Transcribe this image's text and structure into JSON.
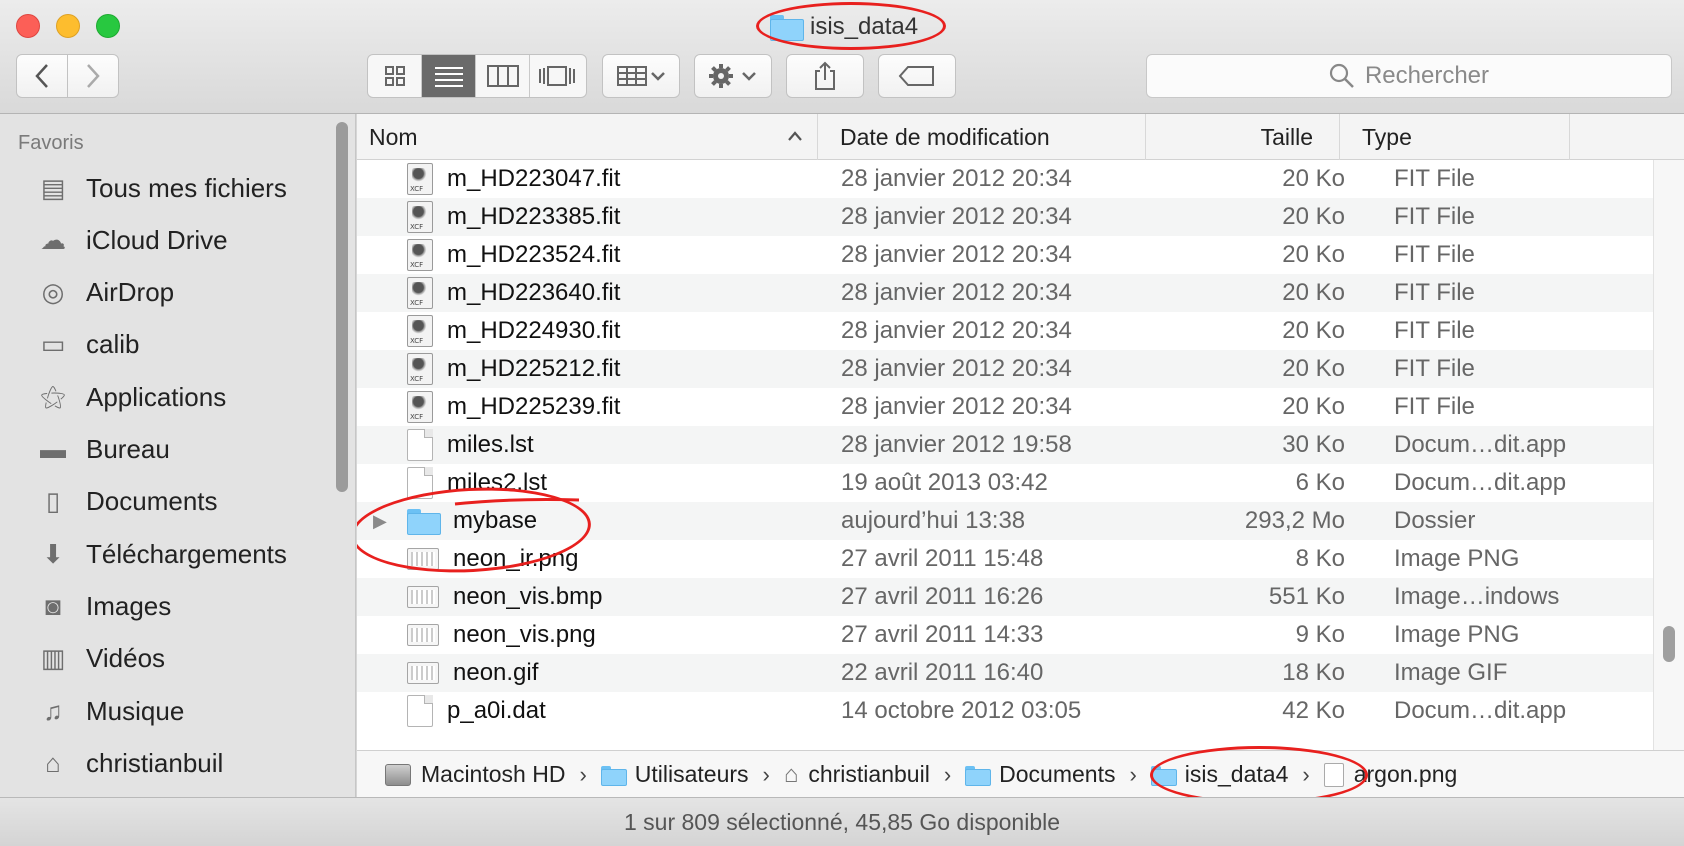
{
  "window": {
    "title": "isis_data4"
  },
  "toolbar": {
    "back_icon": "chevron-left-icon",
    "forward_icon": "chevron-right-icon",
    "view_modes": [
      "icon-view",
      "list-view",
      "column-view",
      "cover-flow-view"
    ],
    "active_view": "list-view",
    "search_placeholder": "Rechercher"
  },
  "sidebar": {
    "heading": "Favoris",
    "items": [
      {
        "label": "Tous mes fichiers",
        "icon": "all-files-icon"
      },
      {
        "label": "iCloud Drive",
        "icon": "cloud-icon"
      },
      {
        "label": "AirDrop",
        "icon": "airdrop-icon"
      },
      {
        "label": "calib",
        "icon": "folder-icon"
      },
      {
        "label": "Applications",
        "icon": "applications-icon"
      },
      {
        "label": "Bureau",
        "icon": "desktop-icon"
      },
      {
        "label": "Documents",
        "icon": "documents-icon"
      },
      {
        "label": "Téléchargements",
        "icon": "download-icon"
      },
      {
        "label": "Images",
        "icon": "camera-icon"
      },
      {
        "label": "Vidéos",
        "icon": "film-icon"
      },
      {
        "label": "Musique",
        "icon": "music-icon"
      },
      {
        "label": "christianbuil",
        "icon": "home-icon"
      }
    ]
  },
  "columns": {
    "name": "Nom",
    "date": "Date de modification",
    "size": "Taille",
    "type": "Type"
  },
  "files": [
    {
      "name": "m_HD223047.fit",
      "date": "28 janvier 2012 20:34",
      "size": "20 Ko",
      "type": "FIT File",
      "icon": "fit"
    },
    {
      "name": "m_HD223385.fit",
      "date": "28 janvier 2012 20:34",
      "size": "20 Ko",
      "type": "FIT File",
      "icon": "fit"
    },
    {
      "name": "m_HD223524.fit",
      "date": "28 janvier 2012 20:34",
      "size": "20 Ko",
      "type": "FIT File",
      "icon": "fit"
    },
    {
      "name": "m_HD223640.fit",
      "date": "28 janvier 2012 20:34",
      "size": "20 Ko",
      "type": "FIT File",
      "icon": "fit"
    },
    {
      "name": "m_HD224930.fit",
      "date": "28 janvier 2012 20:34",
      "size": "20 Ko",
      "type": "FIT File",
      "icon": "fit"
    },
    {
      "name": "m_HD225212.fit",
      "date": "28 janvier 2012 20:34",
      "size": "20 Ko",
      "type": "FIT File",
      "icon": "fit"
    },
    {
      "name": "m_HD225239.fit",
      "date": "28 janvier 2012 20:34",
      "size": "20 Ko",
      "type": "FIT File",
      "icon": "fit"
    },
    {
      "name": "miles.lst",
      "date": "28 janvier 2012 19:58",
      "size": "30 Ko",
      "type": "Docum…dit.app",
      "icon": "doc"
    },
    {
      "name": "miles2.lst",
      "date": "19 août 2013 03:42",
      "size": "6 Ko",
      "type": "Docum…dit.app",
      "icon": "doc"
    },
    {
      "name": "mybase",
      "date": "aujourd’hui 13:38",
      "size": "293,2 Mo",
      "type": "Dossier",
      "icon": "folder"
    },
    {
      "name": "neon_ir.png",
      "date": "27 avril 2011 15:48",
      "size": "8 Ko",
      "type": "Image PNG",
      "icon": "img"
    },
    {
      "name": "neon_vis.bmp",
      "date": "27 avril 2011 16:26",
      "size": "551 Ko",
      "type": "Image…indows",
      "icon": "img"
    },
    {
      "name": "neon_vis.png",
      "date": "27 avril 2011 14:33",
      "size": "9 Ko",
      "type": "Image PNG",
      "icon": "img"
    },
    {
      "name": "neon.gif",
      "date": "22 avril 2011 16:40",
      "size": "18 Ko",
      "type": "Image GIF",
      "icon": "img"
    },
    {
      "name": "p_a0i.dat",
      "date": "14 octobre 2012 03:05",
      "size": "42 Ko",
      "type": "Docum…dit.app",
      "icon": "doc"
    }
  ],
  "pathbar": [
    {
      "label": "Macintosh HD",
      "icon": "hard-drive-icon"
    },
    {
      "label": "Utilisateurs",
      "icon": "folder-icon"
    },
    {
      "label": "christianbuil",
      "icon": "home-icon"
    },
    {
      "label": "Documents",
      "icon": "folder-icon"
    },
    {
      "label": "isis_data4",
      "icon": "folder-icon"
    },
    {
      "label": "argon.png",
      "icon": "image-file-icon"
    }
  ],
  "status": "1 sur 809 sélectionné, 45,85 Go disponible"
}
